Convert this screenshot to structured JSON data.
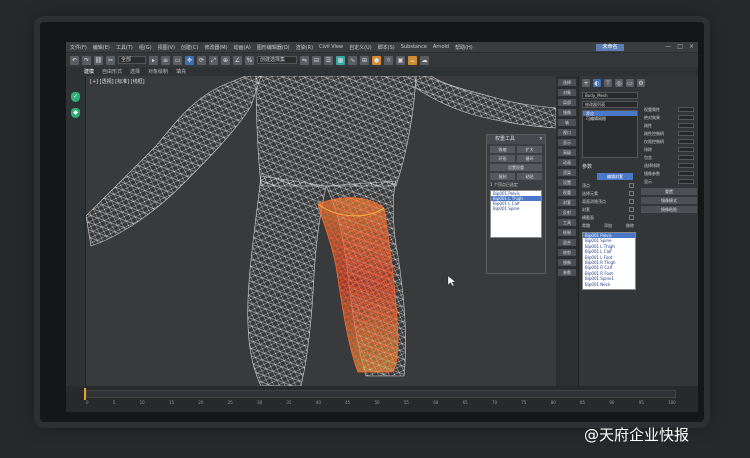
{
  "app": {
    "title_box": "未命名",
    "menu": [
      "文件(F)",
      "编辑(E)",
      "工具(T)",
      "组(G)",
      "视图(V)",
      "创建(C)",
      "修改器(M)",
      "动画(A)",
      "图形编辑器(D)",
      "渲染(R)",
      "Civil View",
      "自定义(U)",
      "脚本(S)",
      "Substance",
      "Arnold",
      "帮助(H)"
    ],
    "window_controls": [
      "—",
      "□",
      "×"
    ]
  },
  "toolbar": {
    "selection_filter": "全部",
    "named_selection": "创建选择集",
    "tabs": [
      "建模",
      "自由形式",
      "选择",
      "对象绘制",
      "填充"
    ]
  },
  "viewport": {
    "label": "[+] [透视] [标准] [线框]",
    "accent_color": "#e84a2a"
  },
  "floating_panel": {
    "title": "权重工具",
    "rows": [
      [
        "收缩",
        "扩大"
      ],
      [
        "环形",
        "循环"
      ],
      [
        "设置权重"
      ],
      [
        "复制",
        "粘贴"
      ]
    ],
    "info": "1 个顶点已选定",
    "list": [
      "Bip001 Pelvis",
      "Bip001 L Thigh",
      "Bip001 L Calf",
      "Bip001 Spine"
    ],
    "selected_index": 1
  },
  "side_buttons": [
    "选择",
    "对象",
    "局部",
    "镜像",
    "轴",
    "视口",
    "显示",
    "高级",
    "动画",
    "渲染",
    "设置",
    "权重",
    "封套",
    "反射",
    "工具",
    "绘制",
    "混合",
    "修剪",
    "镜像",
    "参数"
  ],
  "command_panel": {
    "object_name": "Body_Mesh",
    "modifier_list": "修改器列表",
    "stack": [
      "蒙皮",
      "可编辑网格"
    ],
    "stack_selected": 0,
    "section_params": "参数",
    "edit_envelopes": "编辑封套",
    "params": [
      {
        "label": "顶点",
        "value": ""
      },
      {
        "label": "选择元素",
        "value": ""
      },
      {
        "label": "背面消隐顶点",
        "value": ""
      },
      {
        "label": "封套",
        "value": ""
      },
      {
        "label": "横截面",
        "value": ""
      }
    ],
    "bones_label": "骨骼",
    "add_label": "添加",
    "remove_label": "移除",
    "bones": [
      "Bip001 Pelvis",
      "Bip001 Spine",
      "Bip001 L Thigh",
      "Bip001 L Calf",
      "Bip001 L Foot",
      "Bip001 R Thigh",
      "Bip001 R Calf",
      "Bip001 R Foot",
      "Bip001 Spine1",
      "Bip001 Neck"
    ],
    "bones_selected": 0,
    "right_params": [
      "权重属性",
      "绝对效果",
      "刚性",
      "刚性控制柄",
      "仅限控制柄",
      "排除",
      "包含",
      "选择排除",
      "镜像参数",
      "显示"
    ],
    "right_buttons": [
      "重置",
      "镜像模式",
      "镜像粘贴"
    ]
  },
  "timeline": {
    "ticks": [
      "0",
      "5",
      "10",
      "15",
      "20",
      "25",
      "30",
      "35",
      "40",
      "45",
      "50",
      "55",
      "60",
      "65",
      "70",
      "75",
      "80",
      "85",
      "90",
      "95",
      "100"
    ]
  },
  "watermark": "@天府企业快报"
}
